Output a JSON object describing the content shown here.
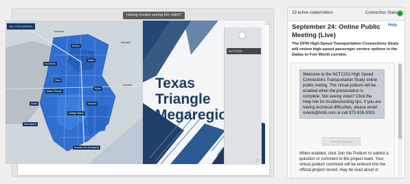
{
  "video": {
    "trouble_button": "Having trouble seeing the video?",
    "map": {
      "logo_left": "Via",
      "logo_right": "Cities",
      "logo_end": "Webex",
      "cities": [
        "Denton",
        "Dallas",
        "Fort Worth",
        "Waco",
        "Austin",
        "San Antonio",
        "Houston",
        "College Station",
        "Killeen-Temple",
        "Bryan",
        "Houston-The Woodlands"
      ],
      "towns": [
        "Oklahoma",
        "Arkansas",
        "Louisiana"
      ]
    },
    "slide_title_lines": [
      "Texas",
      "Triangle",
      "Megaregion"
    ],
    "pip_label": "NCTCOG"
  },
  "side_panel": {
    "stakeholders": "19 active stakeholders",
    "connection_label": "Connection Status:",
    "connection_color": "#1c9b3c",
    "meeting_title": "September 24: Online Public Meeting (Live)",
    "help": "Help",
    "description": "The DFW High-Speed Transportation Connections Study will review high-speed passenger service options in the Dallas to Fort Worth corridor.",
    "notice": "Welcome to the NCTCOG High Speed Connections Transportation Study online public meting. The virtual podium will be enabled when the presentation is complete. Not seeing video? Click the Help link for troubleshooting tips. If you are having technical difficulties, please email nvleck@hntb.com or call 972-628-3003.",
    "join_button": "Join the Podium",
    "after_text": "When enabled, click Join the Podium to submit a question or comment to the project team. Your virtual podium comment will be entered into the official project record, may be read aloud or"
  }
}
